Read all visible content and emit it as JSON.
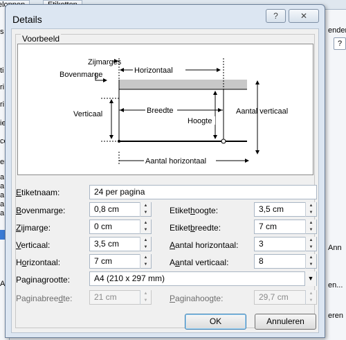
{
  "background": {
    "tabs": [
      "eloppen",
      "Etiketten"
    ],
    "left_fragments": [
      "s",
      "ti",
      "ri",
      "ri",
      "ie",
      "ce",
      "en",
      "a",
      "a",
      "a",
      "a",
      "a",
      "Afi"
    ],
    "right_fragments": [
      "ender",
      "Ann",
      "en...",
      "eren"
    ],
    "right_help": "?"
  },
  "dialog": {
    "title": "Details",
    "help_label": "?",
    "close_label": "✕",
    "group_title": "Voorbeeld",
    "preview": {
      "zijmarges": "Zijmarges",
      "bovenmarge": "Bovenmarge",
      "horizontaal": "Horizontaal",
      "verticaal": "Verticaal",
      "breedte": "Breedte",
      "hoogte": "Hoogte",
      "aantal_verticaal": "Aantal verticaal",
      "aantal_horizontaal": "Aantal horizontaal"
    },
    "fields": {
      "etiketnaam": {
        "label_u": "E",
        "label_rest": "tiketnaam:",
        "value": "24 per pagina"
      },
      "bovenmarge": {
        "label_u": "B",
        "label_rest": "ovenmarge:",
        "value": "0,8 cm"
      },
      "zijmarge": {
        "label_u": "Z",
        "label_rest": "ijmarge:",
        "value": "0 cm"
      },
      "verticaal": {
        "label_u": "V",
        "label_rest": "erticaal:",
        "value": "3,5 cm"
      },
      "horizontaal": {
        "label_pre": "H",
        "label_u": "o",
        "label_rest": "rizontaal:",
        "value": "7 cm"
      },
      "etikethoogte": {
        "label_pre": "Etiket",
        "label_u": "h",
        "label_rest": "oogte:",
        "value": "3,5 cm"
      },
      "etiketbreedte": {
        "label_pre": "Etiket",
        "label_u": "b",
        "label_rest": "reedte:",
        "value": "7 cm"
      },
      "aantal_horizontaal": {
        "label_u": "A",
        "label_rest": "antal horizontaal:",
        "value": "3"
      },
      "aantal_verticaal": {
        "label_pre": "A",
        "label_u": "a",
        "label_rest": "ntal verticaal:",
        "value": "8"
      },
      "paginagrootte": {
        "label": "Paginagrootte:",
        "value": "A4 (210 x 297 mm)"
      },
      "paginabreedte": {
        "label_pre": "Paginabree",
        "label_u": "d",
        "label_rest": "te:",
        "value": "21 cm"
      },
      "paginahoogte": {
        "label_u": "P",
        "label_rest": "aginahoogte:",
        "value": "29,7 cm"
      }
    },
    "ok_label": "OK",
    "cancel_label": "Annuleren"
  }
}
